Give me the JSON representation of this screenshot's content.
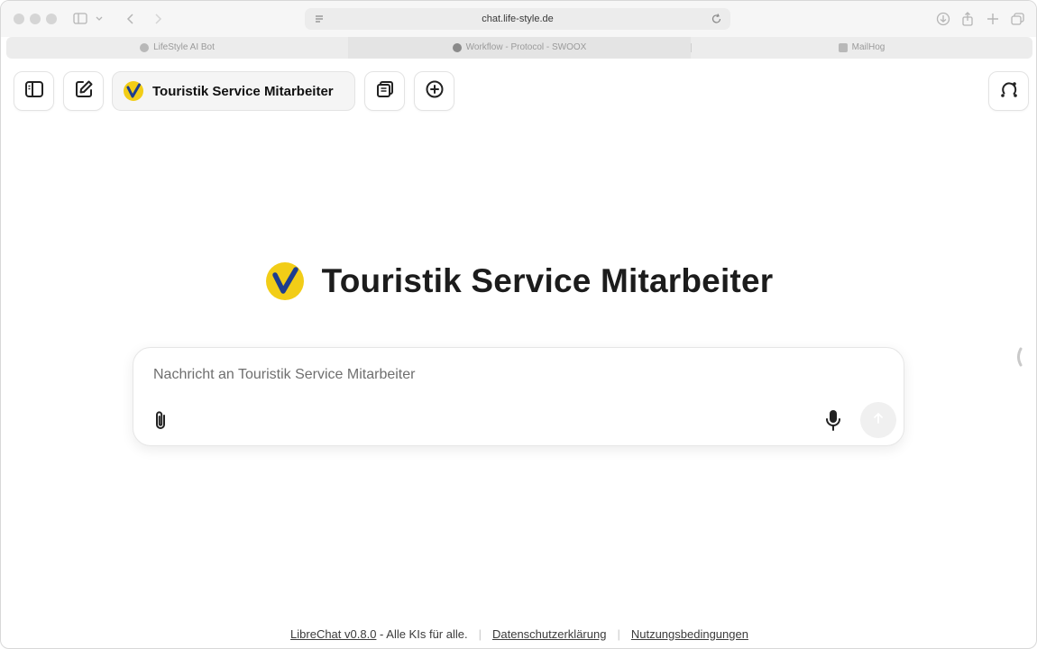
{
  "browser": {
    "url": "chat.life-style.de",
    "tabs": [
      {
        "label": "LifeStyle AI Bot"
      },
      {
        "label": "Workflow - Protocol - SWOOX"
      },
      {
        "label": "MailHog"
      }
    ]
  },
  "toolbar": {
    "model_label": "Touristik Service Mitarbeiter"
  },
  "landing": {
    "title": "Touristik Service Mitarbeiter"
  },
  "composer": {
    "placeholder": "Nachricht an Touristik Service Mitarbeiter"
  },
  "footer": {
    "version_link": "LibreChat v0.8.0",
    "tagline": " - Alle KIs für alle.",
    "privacy_link": "Datenschutzerklärung",
    "terms_link": "Nutzungsbedingungen"
  },
  "colors": {
    "logo_yellow": "#f2cd17",
    "logo_check": "#1d3d8f",
    "text_primary": "#1c1c1c"
  },
  "icons": {
    "sidebar_toggle": "sidebar-icon",
    "new_chat": "edit-icon",
    "copy": "copy-icon",
    "add": "plus-circle-icon",
    "share": "share-chat-icon",
    "attach": "paperclip-icon",
    "mic": "microphone-icon",
    "send": "arrow-up-icon"
  }
}
